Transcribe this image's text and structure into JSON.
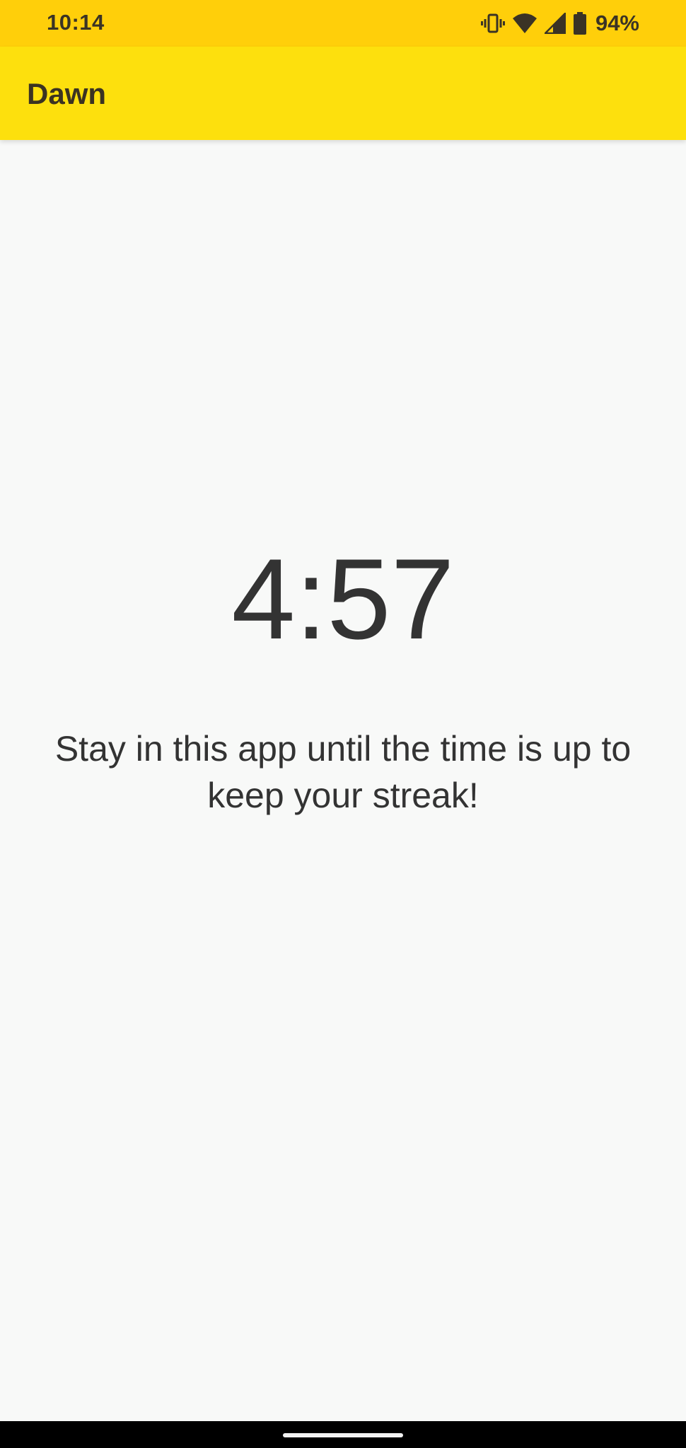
{
  "status_bar": {
    "time": "10:14",
    "battery_percent": "94%",
    "icons": [
      "vibrate-icon",
      "wifi-icon",
      "signal-icon",
      "battery-icon"
    ]
  },
  "app_bar": {
    "title": "Dawn"
  },
  "main": {
    "timer": "4:57",
    "message": "Stay in this app until the time is up to keep your streak!"
  },
  "colors": {
    "status_bar_bg": "#ffcf0a",
    "app_bar_bg": "#fde00d",
    "background": "#f8f9f8",
    "text": "#333333"
  }
}
